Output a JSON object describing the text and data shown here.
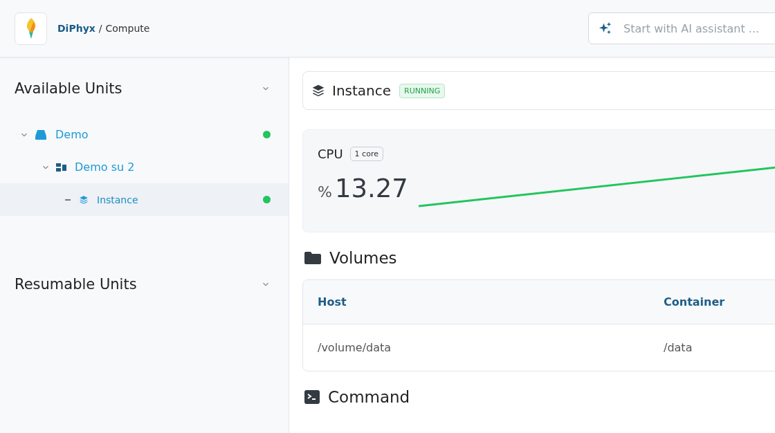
{
  "header": {
    "brand": "DiPhyx",
    "separator": "/",
    "page": "Compute",
    "assistant": {
      "placeholder": "Start with AI assistant ..."
    }
  },
  "sidebar": {
    "sections": [
      {
        "title": "Available Units",
        "tree": [
          {
            "label": "Demo",
            "kind": "server",
            "expanded": true,
            "selected": false,
            "color": "#22c55e",
            "children": [
              {
                "label": "Demo su 2",
                "kind": "group",
                "expanded": true,
                "selected": false,
                "children": [
                  {
                    "label": "Instance",
                    "kind": "instance",
                    "selected": true,
                    "color": "#22c55e"
                  }
                ]
              }
            ]
          }
        ]
      },
      {
        "title": "Resumable Units"
      }
    ]
  },
  "instance": {
    "title": "Instance",
    "status": "RUNNING"
  },
  "cpu": {
    "label": "CPU",
    "cores": "1 core",
    "unit": "%",
    "value": "13.27"
  },
  "volumes": {
    "title": "Volumes",
    "columns": [
      "Host",
      "Container"
    ],
    "rows": [
      [
        "/volume/data",
        "/data"
      ]
    ]
  },
  "command": {
    "title": "Command"
  }
}
